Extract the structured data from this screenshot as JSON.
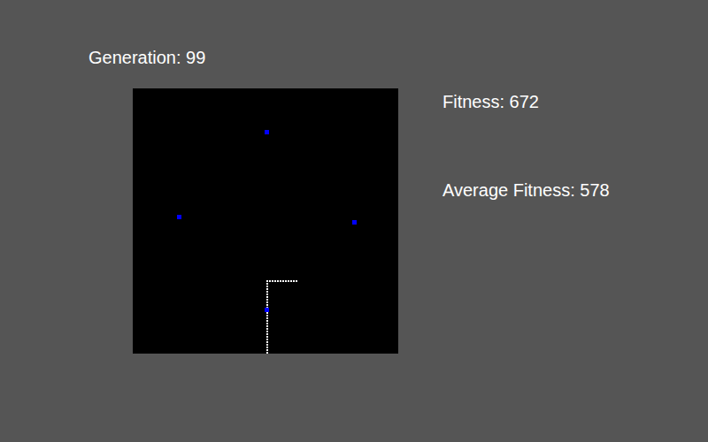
{
  "generation": "Generation: 99",
  "fitness": "Fitness: 672",
  "average_fitness": "Average Fitness: 578",
  "board": {
    "columns": 100,
    "rows": 100,
    "food": [
      {
        "x": 50,
        "y": 16
      },
      {
        "x": 17,
        "y": 48
      },
      {
        "x": 83,
        "y": 50
      },
      {
        "x": 50,
        "y": 83
      }
    ],
    "snake": [
      [
        61,
        72
      ],
      [
        60,
        72
      ],
      [
        59,
        72
      ],
      [
        58,
        72
      ],
      [
        57,
        72
      ],
      [
        56,
        72
      ],
      [
        55,
        72
      ],
      [
        54,
        72
      ],
      [
        53,
        72
      ],
      [
        52,
        72
      ],
      [
        51,
        72
      ],
      [
        50,
        72
      ],
      [
        50,
        73
      ],
      [
        50,
        74
      ],
      [
        50,
        75
      ],
      [
        50,
        76
      ],
      [
        50,
        77
      ],
      [
        50,
        78
      ],
      [
        50,
        79
      ],
      [
        50,
        80
      ],
      [
        50,
        81
      ],
      [
        50,
        82
      ],
      [
        50,
        83
      ],
      [
        50,
        84
      ],
      [
        50,
        85
      ],
      [
        50,
        86
      ],
      [
        50,
        87
      ],
      [
        50,
        88
      ],
      [
        50,
        89
      ],
      [
        50,
        90
      ],
      [
        50,
        91
      ],
      [
        50,
        92
      ],
      [
        50,
        93
      ],
      [
        50,
        94
      ],
      [
        50,
        95
      ],
      [
        50,
        96
      ],
      [
        50,
        97
      ],
      [
        50,
        98
      ],
      [
        50,
        99
      ]
    ]
  }
}
